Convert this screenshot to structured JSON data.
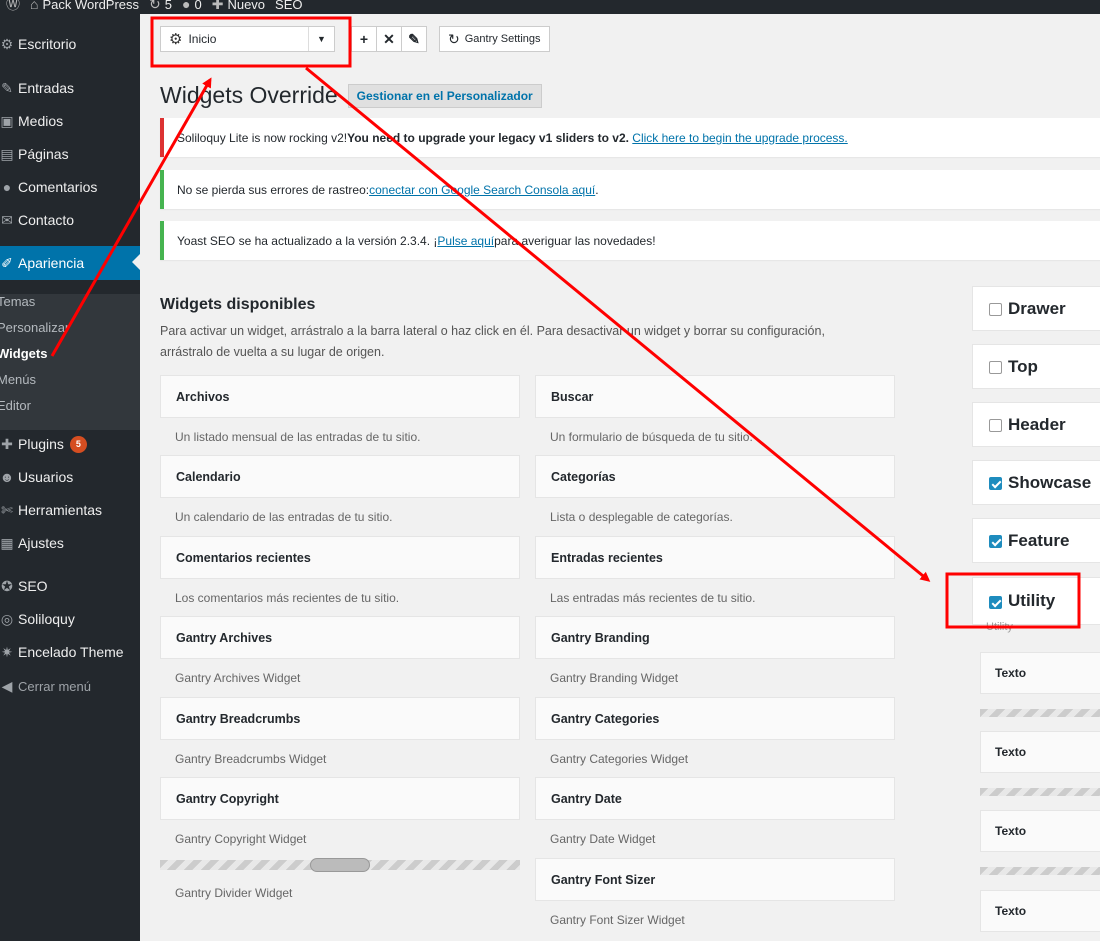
{
  "admin_bar": {
    "site_name": "Pack WordPress",
    "updates_count": "5",
    "comments_count": "0",
    "new_label": "Nuevo",
    "seo_label": "SEO"
  },
  "sidebar": {
    "items": [
      {
        "label": "Escritorio",
        "icon": "dashboard-icon",
        "glyph": "⚙"
      },
      {
        "label": "Entradas",
        "icon": "pin-icon",
        "glyph": "✎"
      },
      {
        "label": "Medios",
        "icon": "media-icon",
        "glyph": "▣"
      },
      {
        "label": "Páginas",
        "icon": "pages-icon",
        "glyph": "▤"
      },
      {
        "label": "Comentarios",
        "icon": "comments-icon",
        "glyph": "●"
      },
      {
        "label": "Contacto",
        "icon": "mail-icon",
        "glyph": "✉"
      },
      {
        "label": "Apariencia",
        "icon": "brush-icon",
        "glyph": "✐"
      },
      {
        "label": "Plugins",
        "icon": "plugins-icon",
        "glyph": "✚"
      },
      {
        "label": "Usuarios",
        "icon": "users-icon",
        "glyph": "☻"
      },
      {
        "label": "Herramientas",
        "icon": "tools-icon",
        "glyph": "✄"
      },
      {
        "label": "Ajustes",
        "icon": "settings-icon",
        "glyph": "▦"
      },
      {
        "label": "SEO",
        "icon": "seo-icon",
        "glyph": "✪"
      },
      {
        "label": "Soliloquy",
        "icon": "soliloquy-icon",
        "glyph": "◎"
      },
      {
        "label": "Encelado Theme",
        "icon": "theme-icon",
        "glyph": "✷"
      },
      {
        "label": "Cerrar menú",
        "icon": "collapse-icon",
        "glyph": "◀"
      }
    ],
    "submenu": [
      "Temas",
      "Personalizar",
      "Widgets",
      "Menús",
      "Editor"
    ],
    "plugins_badge": "5"
  },
  "gantry": {
    "selected_override": "Inicio",
    "settings_label": "Gantry Settings"
  },
  "page": {
    "title": "Widgets Override",
    "action_label": "Gestionar en el Personalizador"
  },
  "notices": [
    {
      "pre": "Soliloquy Lite is now rocking v2! ",
      "bold": "You need to upgrade your legacy v1 sliders to v2.",
      "link": "Click here to begin the upgrade process."
    },
    {
      "pre": "No se pierda sus errores de rastreo: ",
      "link": "conectar con Google Search Consola aquí",
      "post": "."
    },
    {
      "pre": "Yoast SEO se ha actualizado a la versión 2.3.4. ¡",
      "link": "Pulse aquí",
      "post": " para averiguar las novedades!"
    }
  ],
  "available": {
    "title": "Widgets disponibles",
    "description": "Para activar un widget, arrástralo a la barra lateral o haz click en él. Para desactivar un widget y borrar su configuración, arrástralo de vuelta a su lugar de origen."
  },
  "widgets": [
    {
      "title": "Archivos",
      "desc": "Un listado mensual de las entradas de tu sitio."
    },
    {
      "title": "Buscar",
      "desc": "Un formulario de búsqueda de tu sitio."
    },
    {
      "title": "Calendario",
      "desc": "Un calendario de las entradas de tu sitio."
    },
    {
      "title": "Categorías",
      "desc": "Lista o desplegable de categorías."
    },
    {
      "title": "Comentarios recientes",
      "desc": "Los comentarios más recientes de tu sitio."
    },
    {
      "title": "Entradas recientes",
      "desc": "Las entradas más recientes de tu sitio."
    },
    {
      "title": "Gantry Archives",
      "desc": "Gantry Archives Widget"
    },
    {
      "title": "Gantry Branding",
      "desc": "Gantry Branding Widget"
    },
    {
      "title": "Gantry Breadcrumbs",
      "desc": "Gantry Breadcrumbs Widget"
    },
    {
      "title": "Gantry Categories",
      "desc": "Gantry Categories Widget"
    },
    {
      "title": "Gantry Copyright",
      "desc": "Gantry Copyright Widget"
    },
    {
      "title": "Gantry Date",
      "desc": "Gantry Date Widget"
    },
    {
      "title": "Gantry Divider",
      "desc": "Gantry Divider Widget"
    },
    {
      "title": "Gantry Font Sizer",
      "desc": "Gantry Font Sizer Widget"
    }
  ],
  "sidebars": [
    {
      "label": "Drawer",
      "checked": false
    },
    {
      "label": "Top",
      "checked": false
    },
    {
      "label": "Header",
      "checked": false
    },
    {
      "label": "Showcase",
      "checked": true
    },
    {
      "label": "Feature",
      "checked": true
    },
    {
      "label": "Utility",
      "checked": true
    }
  ],
  "utility": {
    "description": "Utility",
    "widgets": [
      "Texto",
      "Texto",
      "Texto",
      "Texto"
    ]
  },
  "colors": {
    "admin_dark": "#23282d",
    "accent_blue": "#0073aa",
    "annotation_red": "#ff0000",
    "badge_orange": "#d54e21"
  }
}
